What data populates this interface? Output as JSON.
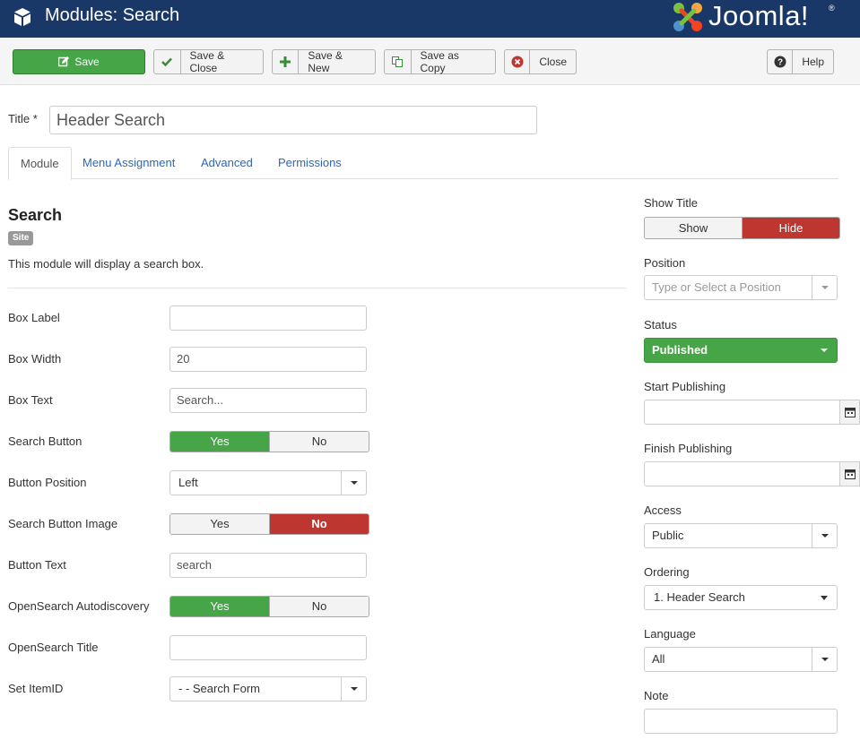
{
  "header": {
    "title": "Modules: Search",
    "logo_text": "Joomla!",
    "logo_reg": "®"
  },
  "toolbar": {
    "save_label": "Save",
    "save_close_label": "Save & Close",
    "save_new_label": "Save & New",
    "save_copy_label": "Save as Copy",
    "close_label": "Close",
    "help_label": "Help"
  },
  "title_field": {
    "label": "Title *",
    "value": "Header Search"
  },
  "tabs": [
    {
      "label": "Module"
    },
    {
      "label": "Menu Assignment"
    },
    {
      "label": "Advanced"
    },
    {
      "label": "Permissions"
    }
  ],
  "module": {
    "name": "Search",
    "badge": "Site",
    "description": "This module will display a search box."
  },
  "fields": {
    "box_label": {
      "label": "Box Label",
      "value": ""
    },
    "box_width": {
      "label": "Box Width",
      "value": "20"
    },
    "box_text": {
      "label": "Box Text",
      "value": "Search..."
    },
    "search_button": {
      "label": "Search Button",
      "yes": "Yes",
      "no": "No"
    },
    "button_position": {
      "label": "Button Position",
      "value": "Left"
    },
    "search_button_image": {
      "label": "Search Button Image",
      "yes": "Yes",
      "no": "No"
    },
    "button_text": {
      "label": "Button Text",
      "value": "search"
    },
    "opensearch_autodiscovery": {
      "label": "OpenSearch Autodiscovery",
      "yes": "Yes",
      "no": "No"
    },
    "opensearch_title": {
      "label": "OpenSearch Title",
      "value": ""
    },
    "set_itemid": {
      "label": "Set ItemID",
      "value": "- - Search Form"
    }
  },
  "sidebar": {
    "show_title": {
      "label": "Show Title",
      "show": "Show",
      "hide": "Hide"
    },
    "position": {
      "label": "Position",
      "placeholder": "Type or Select a Position"
    },
    "status": {
      "label": "Status",
      "value": "Published"
    },
    "start_publishing": {
      "label": "Start Publishing",
      "value": ""
    },
    "finish_publishing": {
      "label": "Finish Publishing",
      "value": ""
    },
    "access": {
      "label": "Access",
      "value": "Public"
    },
    "ordering": {
      "label": "Ordering",
      "value": "1. Header Search"
    },
    "language": {
      "label": "Language",
      "value": "All"
    },
    "note": {
      "label": "Note",
      "value": ""
    }
  },
  "colors": {
    "header_bg": "#1a3867",
    "success": "#46a546",
    "danger": "#bd362f",
    "link": "#2a69b8"
  }
}
